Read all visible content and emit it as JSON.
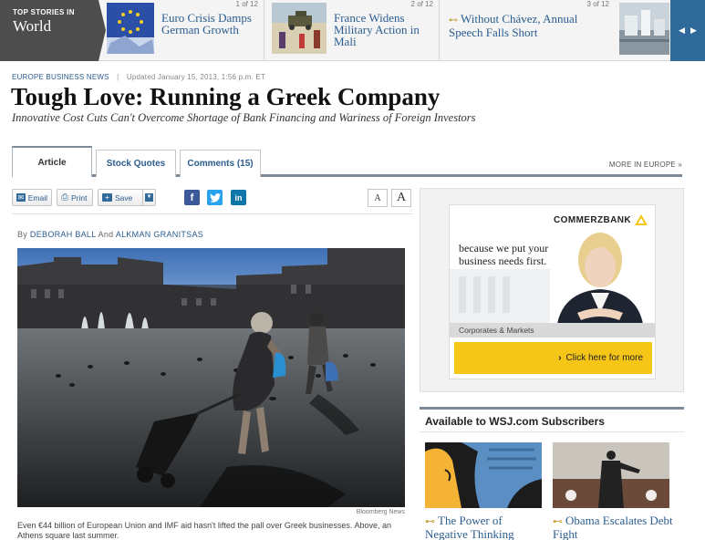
{
  "top_stories": {
    "label_small": "TOP STORIES IN",
    "label_big": "World",
    "items": [
      {
        "count": "1 of 12",
        "headline": "Euro Crisis Damps German Growth"
      },
      {
        "count": "2 of 12",
        "headline": "France Widens Military Action in Mali"
      },
      {
        "count": "3 of 12",
        "headline": "Without Chávez, Annual Speech Falls Short"
      }
    ],
    "prev_icon": "chevron-left-icon",
    "next_icon": "chevron-right-icon"
  },
  "article": {
    "section": "EUROPE BUSINESS NEWS",
    "separator": "|",
    "updated": "Updated January 15, 2013, 1:56 p.m. ET",
    "title": "Tough Love: Running a Greek Company",
    "deck": "Innovative Cost Cuts Can't Overcome Shortage of Bank Financing and Wariness of Foreign Investors",
    "byline_prefix": "By",
    "author_1": "DEBORAH BALL",
    "byline_and": "And",
    "author_2": "ALKMAN GRANITSAS",
    "photo_credit": "Bloomberg News",
    "caption": "Even €44 billion of European Union and IMF aid hasn't lifted the pall over Greek businesses. Above, an Athens square last summer."
  },
  "tabs": [
    {
      "label": "Article",
      "active": true
    },
    {
      "label": "Stock Quotes",
      "active": false
    },
    {
      "label": "Comments (15)",
      "active": false
    }
  ],
  "more_link": "MORE IN EUROPE »",
  "toolbar": {
    "email": "Email",
    "print": "Print",
    "save": "Save",
    "font_small": "A",
    "font_large": "A"
  },
  "ad": {
    "brand": "COMMERZBANK",
    "text": "because we put your business needs first.",
    "band": "Corporates & Markets",
    "cta": "Click here for more",
    "cta_arrow": "›"
  },
  "subscribers": {
    "title": "Available to WSJ.com Subscribers",
    "items": [
      {
        "headline": "The Power of Negative Thinking"
      },
      {
        "headline": "Obama Escalates Debt Fight"
      }
    ]
  },
  "colors": {
    "link": "#2a5d8f",
    "nav_dark": "#4d4d4d",
    "accent_blue": "#2f6a9b",
    "ad_yellow": "#f5c518"
  }
}
